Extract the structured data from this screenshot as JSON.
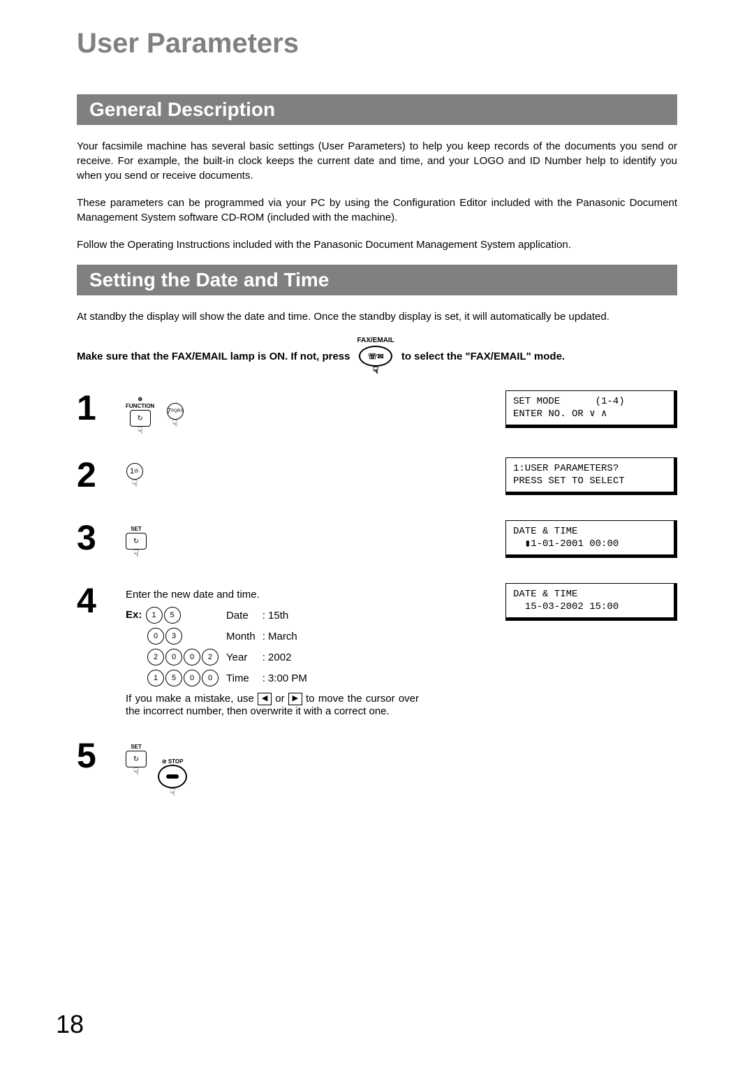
{
  "title": "User Parameters",
  "section1": {
    "header": "General Description",
    "p1": "Your facsimile machine has several basic settings (User Parameters) to help you keep records of the documents you send or receive. For example, the built-in clock keeps the current date and time, and your LOGO and ID Number help to identify you when you send or receive documents.",
    "p2": "These parameters can be programmed via your PC by using the Configuration Editor included with the Panasonic Document Management System software CD-ROM (included with the machine).",
    "p3": "Follow the Operating Instructions included with the Panasonic Document Management System application."
  },
  "section2": {
    "header": "Setting the Date and Time",
    "intro": "At standby the display will show the date and time. Once the standby display is set, it will automatically be updated.",
    "make_sure_pre": "Make sure that the FAX/EMAIL lamp is ON.  If not, press",
    "make_sure_post": "to select the \"FAX/EMAIL\" mode.",
    "fax_email_label": "FAX/EMAIL",
    "fax_email_icon": "☏✉"
  },
  "steps": {
    "s1": {
      "num": "1",
      "function_label": "FUNCTION",
      "key7": "7",
      "key7_sub": "PQRS",
      "display": "SET MODE      (1-4)\nENTER NO. OR ∨ ∧"
    },
    "s2": {
      "num": "2",
      "key1": "1",
      "key1_sub": "@.",
      "display": "1:USER PARAMETERS?\nPRESS SET TO SELECT"
    },
    "s3": {
      "num": "3",
      "set_label": "SET",
      "display": "DATE & TIME\n  ▮1-01-2001 00:00"
    },
    "s4": {
      "num": "4",
      "line1": "Enter the new date and time.",
      "ex_label": "Ex:",
      "rows": [
        {
          "keys": [
            "1",
            "5"
          ],
          "label": "Date",
          "value": ": 15th"
        },
        {
          "keys": [
            "0",
            "3"
          ],
          "label": "Month",
          "value": ": March"
        },
        {
          "keys": [
            "2",
            "0",
            "0",
            "2"
          ],
          "label": "Year",
          "value": ": 2002"
        },
        {
          "keys": [
            "1",
            "5",
            "0",
            "0"
          ],
          "label": "Time",
          "value": ": 3:00 PM"
        }
      ],
      "note_pre": "If you make a mistake, use ",
      "note_mid": " or ",
      "note_post": " to move the cursor over the incorrect number, then overwrite it with a correct one.",
      "arrow_left": "◀",
      "arrow_right": "▶",
      "display": "DATE & TIME\n  15-03-2002 15:00"
    },
    "s5": {
      "num": "5",
      "set_label": "SET",
      "stop_label": "⊘ STOP"
    }
  },
  "page_number": "18"
}
